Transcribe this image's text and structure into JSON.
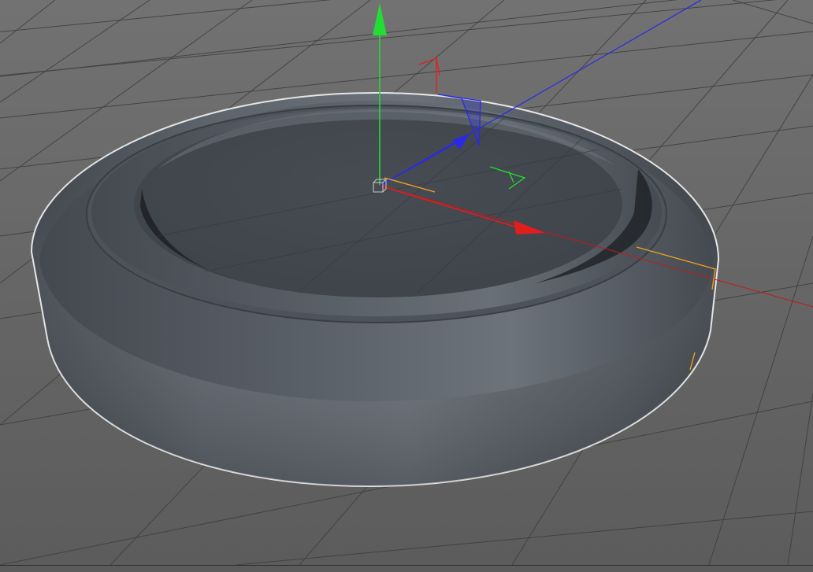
{
  "viewport": {
    "view": "perspective",
    "background_color": "#5e5e5e",
    "grid_color": "#3a3a3a",
    "object": {
      "type": "rounded-disc",
      "body_color": "#4e545b",
      "top_color": "#44484f",
      "outline_color": "#e8e8e8"
    },
    "gizmo": {
      "x_axis_color": "#e01e1e",
      "y_axis_color": "#22dd33",
      "z_axis_color": "#2a2ae6",
      "handle_color": "#f0a020"
    }
  }
}
